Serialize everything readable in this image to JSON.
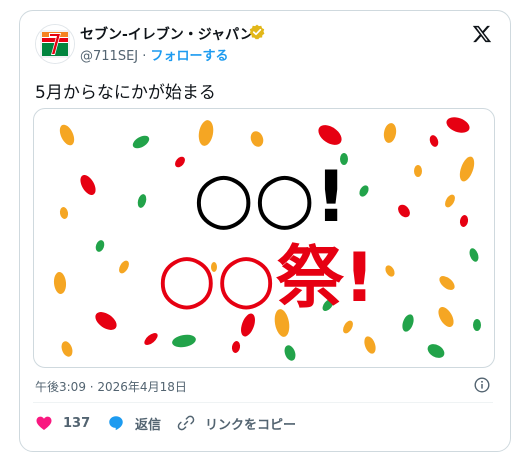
{
  "account": {
    "name": "セブン‐イレブン・ジャパン",
    "handle": "@711SEJ",
    "separator": "·",
    "follow_label": "フォローする"
  },
  "tweet": {
    "text": "5月からなにかが始まる",
    "image": {
      "line1": "○○!",
      "line2": "○○祭!"
    },
    "timestamp": "午後3:09 · 2026年4月18日"
  },
  "actions": {
    "likes_count": "137",
    "reply_label": "返信",
    "copy_link_label": "リンクをコピー"
  },
  "colors": {
    "accent": "#1d9bf0",
    "like": "#f91880",
    "verified": "#e2b719",
    "image_red": "#e60012",
    "image_black": "#000000"
  },
  "icons": [
    "seven-eleven-logo-icon",
    "verified-badge-icon",
    "x-logo-icon",
    "info-icon",
    "heart-icon",
    "reply-bubble-icon",
    "link-icon"
  ]
}
